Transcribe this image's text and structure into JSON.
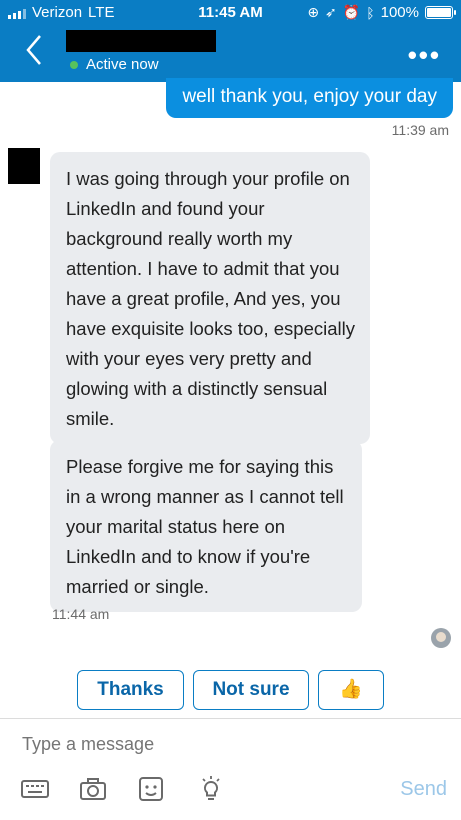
{
  "status_bar": {
    "carrier": "Verizon",
    "network": "LTE",
    "time": "11:45 AM",
    "battery": "100%",
    "battery_fraction": 1.0
  },
  "header": {
    "status": "Active now",
    "back_icon": "chevron-left-icon",
    "more_icon": "more-options-icon"
  },
  "messages": {
    "sent_text": "well thank you, enjoy your day",
    "sent_time": "11:39 am",
    "received_1": "I was going through your profile on LinkedIn and found your background really worth my attention. I have to admit that you have a great profile, And yes, you have exquisite looks too, especially with your eyes very pretty and glowing with a distinctly sensual smile.",
    "received_2": "Please forgive me for saying this in a wrong manner as I cannot tell your marital status here on LinkedIn and to know if you're married or single.",
    "received_time": "11:44 am"
  },
  "quick_replies": {
    "thanks": "Thanks",
    "not_sure": "Not sure",
    "thumbs_up": "👍"
  },
  "composer": {
    "placeholder": "Type a message",
    "send_label": "Send"
  },
  "colors": {
    "brand_blue": "#0a7dc4",
    "sent_bubble": "#0b8fe0",
    "received_bubble": "#eaecef",
    "active_dot": "#57c35d"
  }
}
